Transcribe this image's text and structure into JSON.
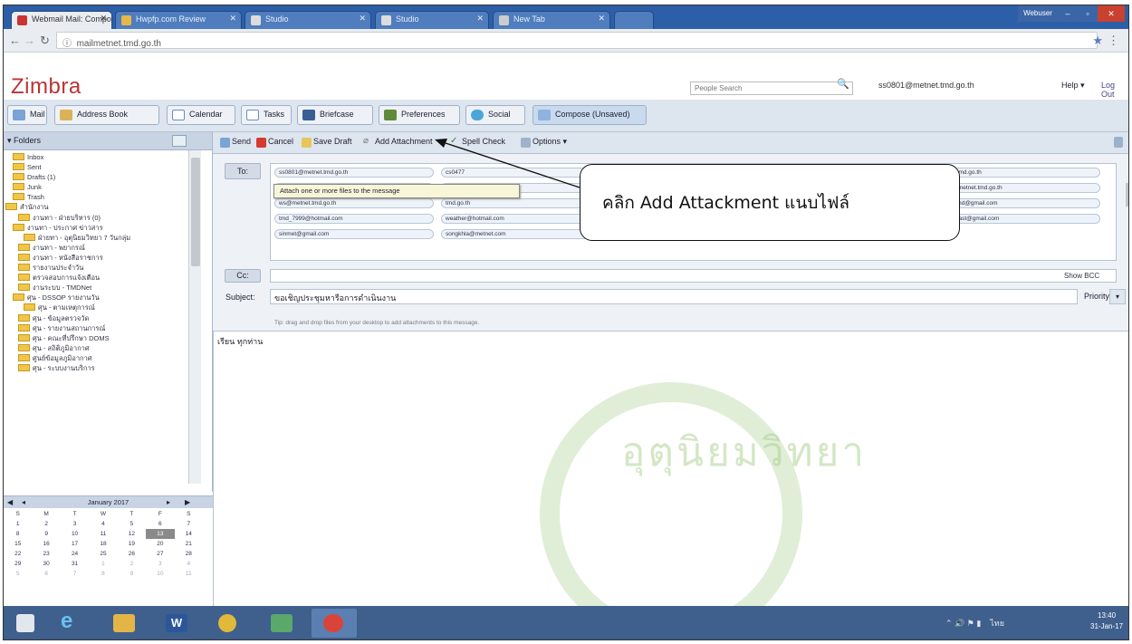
{
  "browser": {
    "tabs": [
      "Webmail Mail: Compose",
      "Hwpfp.com Review",
      "Studio",
      "Studio",
      "New Tab"
    ],
    "url": "mailmetnet.tmd.go.th",
    "window_user": "Webuser"
  },
  "header": {
    "logo": "Zimbra",
    "search_placeholder": "People Search",
    "account": "ss0801@metnet.tmd.go.th",
    "help": "Help",
    "logout": "Log Out"
  },
  "app_tabs": [
    "Mail",
    "Address Book",
    "Calendar",
    "Tasks",
    "Briefcase",
    "Preferences",
    "Social",
    "Compose (Unsaved)"
  ],
  "sidebar": {
    "title": "Folders",
    "folders": [
      "Inbox",
      "Sent",
      "Drafts (1)",
      "Junk",
      "Trash",
      "สำนักงาน",
      "งานทา - ฝ่ายบริหาร (0)",
      "งานทา - ประกาศ ข่าวสาร",
      "ฝ่ายทา - อุตุนิยมวิทยา 7 วันกลุ่ม",
      "งานทา - พยากรณ์",
      "งานทา - หนังสือราชการ",
      "รายงานประจำวัน",
      "ตรวจสอบการแจ้งเตือน",
      "งานระบบ - TMDNet",
      "ศุน - DSSOP รายงานวัน",
      "ศุน - ตามเหตุการณ์",
      "ศุน - ข้อมูลตรวจวัด",
      "ศุน - รายงานสถานการณ์",
      "ศุน - คณะที่ปรึกษา DOMS",
      "ศุน - สถิติภูมิอากาศ",
      "ศูนย์ข้อมูลภูมิอากาศ",
      "ศุน - ระบบงานบริการ"
    ]
  },
  "calendar": {
    "month": "January 2017",
    "weekdays": [
      "S",
      "M",
      "T",
      "W",
      "T",
      "F",
      "S"
    ],
    "weeks": [
      [
        "1",
        "2",
        "3",
        "4",
        "5",
        "6",
        "7"
      ],
      [
        "8",
        "9",
        "10",
        "11",
        "12",
        "13",
        "14"
      ],
      [
        "15",
        "16",
        "17",
        "18",
        "19",
        "20",
        "21"
      ],
      [
        "22",
        "23",
        "24",
        "25",
        "26",
        "27",
        "28"
      ],
      [
        "29",
        "30",
        "31",
        "1",
        "2",
        "3",
        "4"
      ],
      [
        "5",
        "6",
        "7",
        "8",
        "9",
        "10",
        "11"
      ]
    ]
  },
  "compose": {
    "toolbar": [
      "Send",
      "Cancel",
      "Save Draft",
      "Add Attachment",
      "Spell Check",
      "Options"
    ],
    "to_label": "To:",
    "cc_label": "Cc:",
    "show_bcc": "Show BCC",
    "subject_label": "Subject:",
    "subject": "ขอเชิญประชุมหารือการดำเนินงาน",
    "priority_label": "Priority:",
    "drag_tip": "Tip: drag and drop files from your desktop to add attachments to this message.",
    "body": "เรียน ทุกท่าน",
    "attach_tooltip": "Attach one or more files to the message",
    "recipients": [
      "ss0801@metnet.tmd.go.th",
      "cs0477",
      "obs@metnet.tmd.go.th",
      "ss0802@metnet.tmd.go.th",
      "met.tmd.go.th",
      "ss0803@metnet.tmd.go.th",
      "ss0804@metnet.tmd.go.th",
      "met.tmd.go.th",
      "cmd@metnet.tmd.go.th",
      "rfc@metnet.tmd.go.th",
      "ws@metnet.tmd.go.th",
      "tmd.go.th",
      "ss0806@chiangmai.com",
      "pax.songkhla@gmail.com",
      "jutatmd@gmail.com",
      "tmd_7999@hotmail.com",
      "weather@hotmail.com",
      "cs0000@hotmail.com",
      "apitcha@gmail.com",
      "forecast@gmail.com",
      "sinmet@gmail.com",
      "songkhla@metnet.com",
      "ofsea@gmail.com",
      "ubon_wea@hotmail.com"
    ]
  },
  "annotation": {
    "text": "คลิก Add Attackment แนบไฟล์"
  },
  "watermark": {
    "text": "อุตุนิยมวิทยา"
  },
  "taskbar": {
    "items": [
      "start",
      "internet-explorer",
      "file-explorer",
      "word",
      "chrome",
      "snipping-tool",
      "chrome-active"
    ],
    "tray_lang": "ไทย",
    "clock_time": "13:40",
    "clock_date": "31-Jan-17"
  },
  "colors": {
    "zimbra_red": "#b33333",
    "browser_chrome": "#2d5fa8",
    "zimbra_toolbar": "#dde5ef",
    "taskbar": "#3f5f8d"
  }
}
